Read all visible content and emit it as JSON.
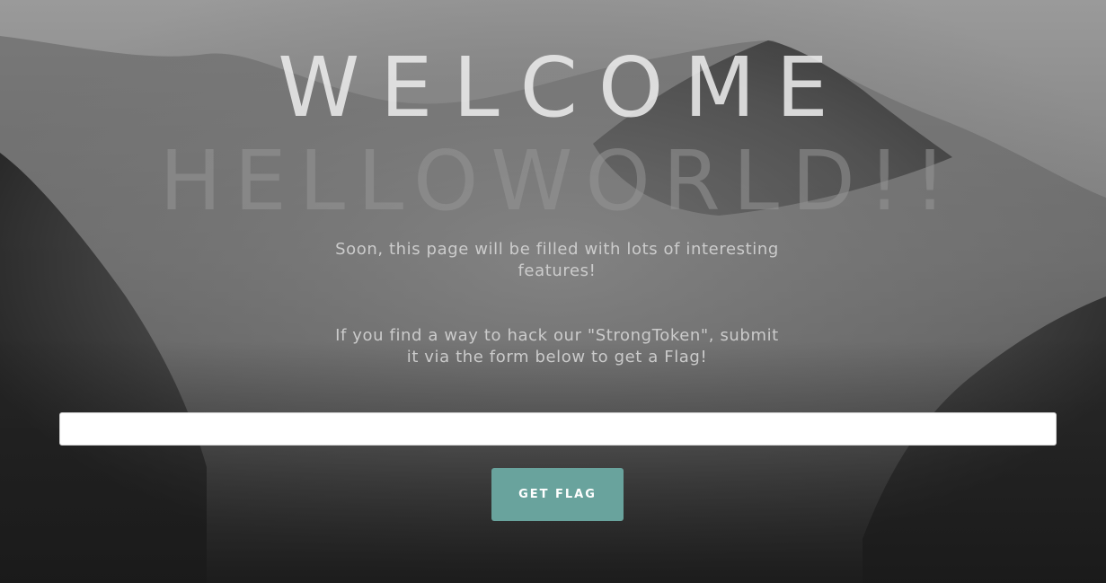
{
  "hero": {
    "line1": "WELCOME",
    "line2": "HELLOWORLD!!"
  },
  "intro": {
    "text": "Soon, this page will be filled with lots of interesting features!"
  },
  "challenge": {
    "text": "If you find a way to hack our \"StrongToken\", submit it via the form below to get a Flag!"
  },
  "form": {
    "token_value": "",
    "token_placeholder": "",
    "submit_label": "GET FLAG"
  },
  "colors": {
    "button": "#69a39d",
    "input_bg": "#ffffff",
    "background": "#6f6f6f"
  }
}
